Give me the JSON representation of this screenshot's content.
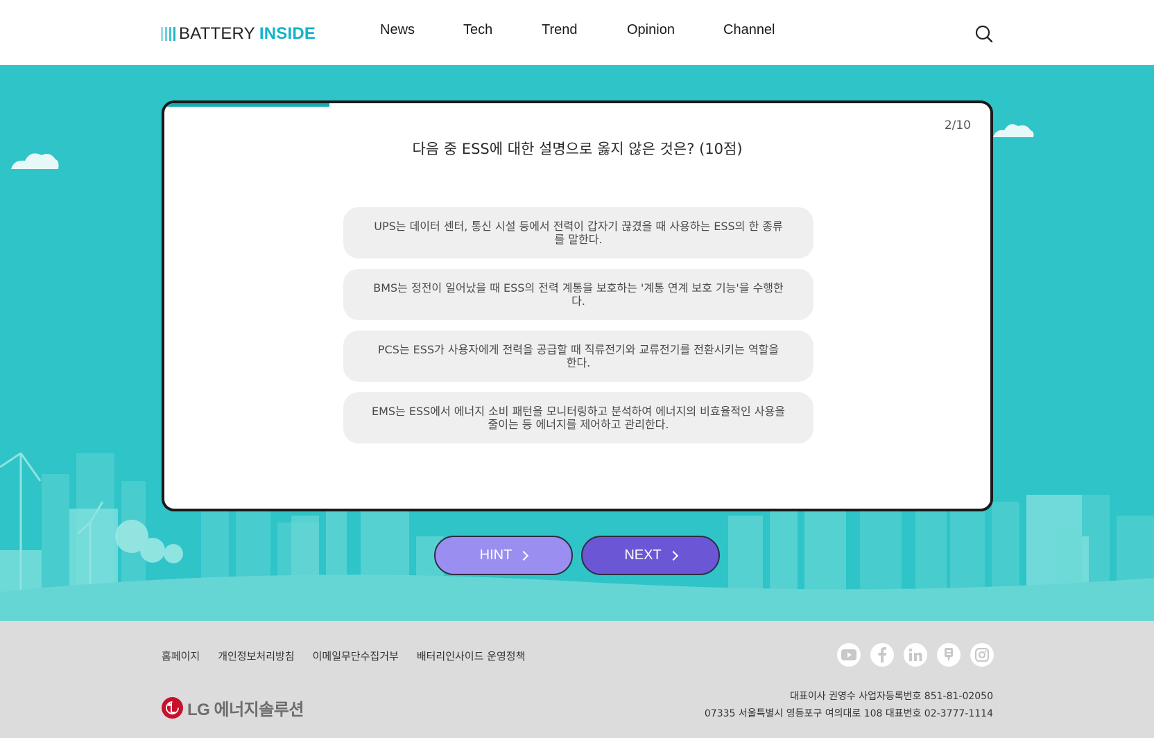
{
  "header": {
    "logo_left": "BATTERY",
    "logo_right": "INSIDE",
    "nav": [
      "News",
      "Tech",
      "Trend",
      "Opinion",
      "Channel"
    ],
    "search_icon": "search-icon"
  },
  "quiz": {
    "counter": "2/10",
    "progress": 0.2,
    "question": "다음 중 ESS에 대한 설명으로 옳지 않은 것은? (10점)",
    "options": [
      "UPS는 데이터 센터, 통신 시설 등에서 전력이 갑자기 끊겼을 때 사용하는 ESS의 한 종류를 말한다.",
      "BMS는 정전이 일어났을 때 ESS의 전력 계통을 보호하는 '계통 연계 보호 기능'을 수행한다.",
      "PCS는 ESS가 사용자에게 전력을 공급할 때 직류전기와 교류전기를 전환시키는 역할을 한다.",
      "EMS는 ESS에서 에너지 소비 패턴을 모니터링하고 분석하여 에너지의 비효율적인 사용을 줄이는 등 에너지를 제어하고 관리한다."
    ],
    "hint_label": "HINT",
    "next_label": "NEXT"
  },
  "colors": {
    "background": "#2ec4c8",
    "accent": "#14aeb0",
    "hint_button": "#9a8ff0",
    "next_button": "#6b57d6",
    "lg_red": "#c8102e"
  },
  "footer": {
    "links": [
      "홈페이지",
      "개인정보처리방침",
      "이메일무단수집거부",
      "배터리인사이드 운영정책"
    ],
    "social_icons": [
      "youtube-icon",
      "facebook-icon",
      "linkedin-icon",
      "blog-icon",
      "instagram-icon"
    ],
    "brand": "LG 에너지솔루션",
    "corp_line1": "대표이사 권영수 사업자등록번호 851-81-02050",
    "corp_line2": "07335 서울특별시 영등포구 여의대로 108 대표번호 02-3777-1114"
  }
}
